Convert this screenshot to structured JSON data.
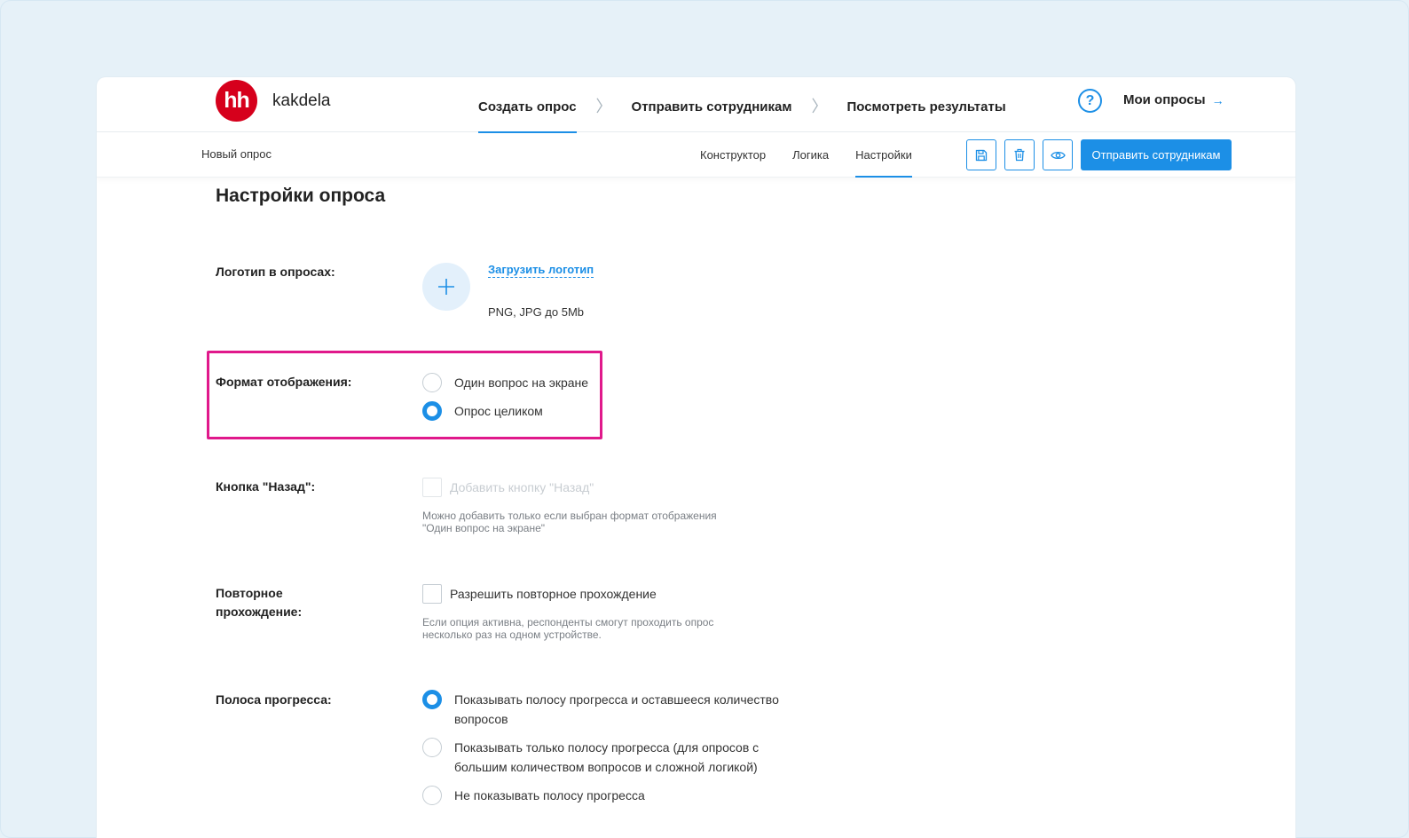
{
  "header": {
    "logo_text": "hh",
    "brand": "kakdela",
    "steps": [
      "Создать опрос",
      "Отправить сотрудникам",
      "Посмотреть результаты"
    ],
    "step_separator": "〉",
    "help_icon_text": "?",
    "my_surveys_label": "Мои опросы",
    "my_surveys_arrow": "→"
  },
  "subheader": {
    "survey_name": "Новый опрос",
    "tabs": [
      "Конструктор",
      "Логика",
      "Настройки"
    ],
    "active_tab": "Настройки",
    "toolbar_icons": [
      "save-icon",
      "trash-icon",
      "eye-icon"
    ],
    "send_button": "Отправить сотрудникам"
  },
  "page": {
    "title": "Настройки опроса",
    "logo": {
      "label": "Логотип в опросах:",
      "upload_link": "Загрузить логотип",
      "hint": "PNG, JPG до 5Mb"
    },
    "display_format": {
      "label": "Формат отображения:",
      "options": [
        "Один вопрос на экране",
        "Опрос целиком"
      ],
      "selected": "Опрос целиком"
    },
    "back_button": {
      "label": "Кнопка \"Назад\":",
      "checkbox_label": "Добавить кнопку \"Назад\"",
      "checked": false,
      "disabled": true,
      "hint_line1": "Можно добавить только если выбран формат отображения",
      "hint_line2": "\"Один вопрос на экране\""
    },
    "retake": {
      "label_line1": "Повторное",
      "label_line2": "прохождение:",
      "checkbox_label": "Разрешить повторное прохождение",
      "checked": false,
      "hint_line1": "Если опция активна, респонденты смогут проходить опрос",
      "hint_line2": "несколько раз на одном устройстве."
    },
    "progress_bar": {
      "label": "Полоса прогресса:",
      "options": [
        "Показывать полосу прогресса и оставшееся количество вопросов",
        "Показывать только полосу прогресса (для опросов с большим количеством вопросов и сложной логикой)",
        "Не показывать полосу прогресса"
      ],
      "selected": "Показывать полосу прогресса и оставшееся количество вопросов"
    }
  },
  "colors": {
    "accent": "#1c8fe6",
    "brand_red": "#d6001c",
    "highlight": "#e0198b",
    "background": "#e6f1f8"
  }
}
